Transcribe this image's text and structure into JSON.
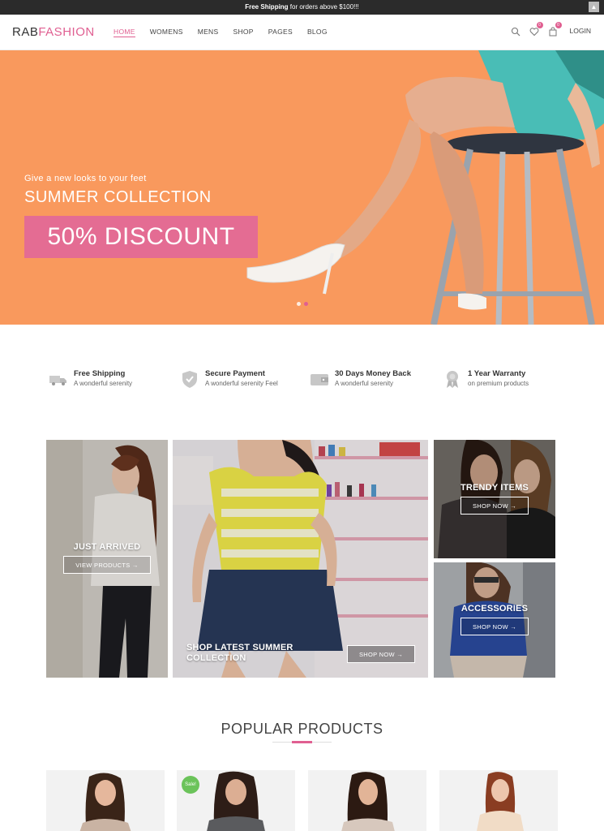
{
  "topbar": {
    "bold": "Free Shipping",
    "text": " for orders above $100!!!",
    "scroll_icon": "chevron-up-icon"
  },
  "header": {
    "logo_main": "RAB",
    "logo_accent": "FASHION",
    "nav": [
      "HOME",
      "WOMENS",
      "MENS",
      "SHOP",
      "PAGES",
      "BLOG"
    ],
    "active_nav": "HOME",
    "wishlist_count": "0",
    "cart_count": "0",
    "login_label": "LOGIN",
    "icons": [
      "search-icon",
      "heart-icon",
      "cart-icon"
    ]
  },
  "hero": {
    "subtitle": "Give a new looks to your feet",
    "title": "SUMMER COLLECTION",
    "discount": "50% DISCOUNT",
    "slides": 2,
    "active_slide": 2,
    "background": "#f9995d",
    "accent": "#e46c93"
  },
  "features": [
    {
      "title": "Free Shipping",
      "subtitle": "A wonderful serenity",
      "icon": "truck-icon"
    },
    {
      "title": "Secure Payment",
      "subtitle": "A wonderful serenity Feel",
      "icon": "shield-icon"
    },
    {
      "title": "30 Days Money Back",
      "subtitle": "A wonderful serenity",
      "icon": "wallet-icon"
    },
    {
      "title": "1 Year Warranty",
      "subtitle": "on premium products",
      "icon": "award-icon"
    }
  ],
  "promos": {
    "just_arrived": {
      "title": "JUST ARRIVED",
      "button": "VIEW PRODUCTS →"
    },
    "summer": {
      "title_line1": "SHOP LATEST SUMMER",
      "title_line2": "COLLECTION",
      "button": "SHOP NOW →"
    },
    "trendy": {
      "title": "TRENDY ITEMS",
      "button": "SHOP NOW →"
    },
    "accessories": {
      "title": "ACCESSORIES",
      "button": "SHOP NOW →"
    }
  },
  "popular": {
    "title": "POPULAR PRODUCTS",
    "sale_label": "Sale!"
  },
  "colors": {
    "accent": "#e05f91",
    "topbar": "#2b2b2b",
    "sale": "#6bc35a"
  }
}
